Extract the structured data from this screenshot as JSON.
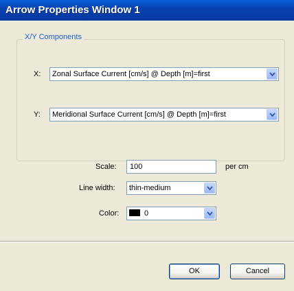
{
  "window": {
    "title": "Arrow Properties Window 1"
  },
  "components": {
    "legend": "X/Y Components",
    "x_label": "X:",
    "x_value": "Zonal Surface Current [cm/s] @ Depth [m]=first",
    "y_label": "Y:",
    "y_value": "Meridional Surface Current [cm/s] @ Depth [m]=first"
  },
  "scale": {
    "label": "Scale:",
    "value": "100",
    "unit": "per cm"
  },
  "line_width": {
    "label": "Line width:",
    "value": "thin-medium"
  },
  "color": {
    "label": "Color:",
    "value": "0",
    "swatch": "#000000"
  },
  "buttons": {
    "ok": "OK",
    "cancel": "Cancel"
  },
  "icons": {
    "dropdown": "chevron-down-icon"
  }
}
